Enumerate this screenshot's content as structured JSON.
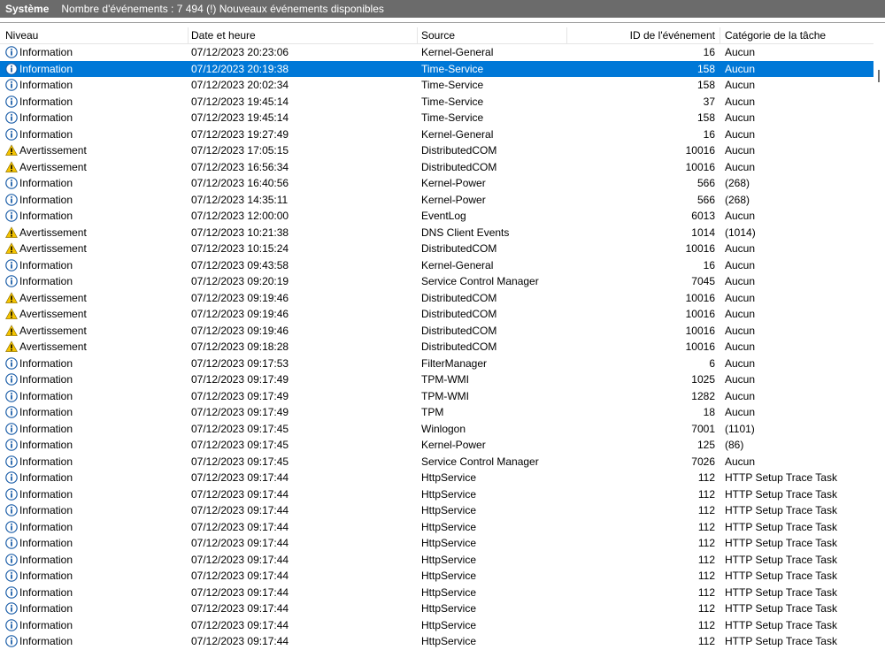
{
  "titlebar": {
    "title": "Système",
    "info": "Nombre d'événements : 7 494 (!) Nouveaux événements disponibles"
  },
  "columns": {
    "level": "Niveau",
    "date": "Date et heure",
    "source": "Source",
    "id": "ID de l'événement",
    "category": "Catégorie de la tâche"
  },
  "selected_row_index": 1,
  "rows": [
    {
      "level": "Information",
      "icon": "info",
      "date": "07/12/2023 20:23:06",
      "source": "Kernel-General",
      "id": "16",
      "category": "Aucun"
    },
    {
      "level": "Information",
      "icon": "info",
      "date": "07/12/2023 20:19:38",
      "source": "Time-Service",
      "id": "158",
      "category": "Aucun"
    },
    {
      "level": "Information",
      "icon": "info",
      "date": "07/12/2023 20:02:34",
      "source": "Time-Service",
      "id": "158",
      "category": "Aucun"
    },
    {
      "level": "Information",
      "icon": "info",
      "date": "07/12/2023 19:45:14",
      "source": "Time-Service",
      "id": "37",
      "category": "Aucun"
    },
    {
      "level": "Information",
      "icon": "info",
      "date": "07/12/2023 19:45:14",
      "source": "Time-Service",
      "id": "158",
      "category": "Aucun"
    },
    {
      "level": "Information",
      "icon": "info",
      "date": "07/12/2023 19:27:49",
      "source": "Kernel-General",
      "id": "16",
      "category": "Aucun"
    },
    {
      "level": "Avertissement",
      "icon": "warning",
      "date": "07/12/2023 17:05:15",
      "source": "DistributedCOM",
      "id": "10016",
      "category": "Aucun"
    },
    {
      "level": "Avertissement",
      "icon": "warning",
      "date": "07/12/2023 16:56:34",
      "source": "DistributedCOM",
      "id": "10016",
      "category": "Aucun"
    },
    {
      "level": "Information",
      "icon": "info",
      "date": "07/12/2023 16:40:56",
      "source": "Kernel-Power",
      "id": "566",
      "category": "(268)"
    },
    {
      "level": "Information",
      "icon": "info",
      "date": "07/12/2023 14:35:11",
      "source": "Kernel-Power",
      "id": "566",
      "category": "(268)"
    },
    {
      "level": "Information",
      "icon": "info",
      "date": "07/12/2023 12:00:00",
      "source": "EventLog",
      "id": "6013",
      "category": "Aucun"
    },
    {
      "level": "Avertissement",
      "icon": "warning",
      "date": "07/12/2023 10:21:38",
      "source": "DNS Client Events",
      "id": "1014",
      "category": "(1014)"
    },
    {
      "level": "Avertissement",
      "icon": "warning",
      "date": "07/12/2023 10:15:24",
      "source": "DistributedCOM",
      "id": "10016",
      "category": "Aucun"
    },
    {
      "level": "Information",
      "icon": "info",
      "date": "07/12/2023 09:43:58",
      "source": "Kernel-General",
      "id": "16",
      "category": "Aucun"
    },
    {
      "level": "Information",
      "icon": "info",
      "date": "07/12/2023 09:20:19",
      "source": "Service Control Manager",
      "id": "7045",
      "category": "Aucun"
    },
    {
      "level": "Avertissement",
      "icon": "warning",
      "date": "07/12/2023 09:19:46",
      "source": "DistributedCOM",
      "id": "10016",
      "category": "Aucun"
    },
    {
      "level": "Avertissement",
      "icon": "warning",
      "date": "07/12/2023 09:19:46",
      "source": "DistributedCOM",
      "id": "10016",
      "category": "Aucun"
    },
    {
      "level": "Avertissement",
      "icon": "warning",
      "date": "07/12/2023 09:19:46",
      "source": "DistributedCOM",
      "id": "10016",
      "category": "Aucun"
    },
    {
      "level": "Avertissement",
      "icon": "warning",
      "date": "07/12/2023 09:18:28",
      "source": "DistributedCOM",
      "id": "10016",
      "category": "Aucun"
    },
    {
      "level": "Information",
      "icon": "info",
      "date": "07/12/2023 09:17:53",
      "source": "FilterManager",
      "id": "6",
      "category": "Aucun"
    },
    {
      "level": "Information",
      "icon": "info",
      "date": "07/12/2023 09:17:49",
      "source": "TPM-WMI",
      "id": "1025",
      "category": "Aucun"
    },
    {
      "level": "Information",
      "icon": "info",
      "date": "07/12/2023 09:17:49",
      "source": "TPM-WMI",
      "id": "1282",
      "category": "Aucun"
    },
    {
      "level": "Information",
      "icon": "info",
      "date": "07/12/2023 09:17:49",
      "source": "TPM",
      "id": "18",
      "category": "Aucun"
    },
    {
      "level": "Information",
      "icon": "info",
      "date": "07/12/2023 09:17:45",
      "source": "Winlogon",
      "id": "7001",
      "category": "(1101)"
    },
    {
      "level": "Information",
      "icon": "info",
      "date": "07/12/2023 09:17:45",
      "source": "Kernel-Power",
      "id": "125",
      "category": "(86)"
    },
    {
      "level": "Information",
      "icon": "info",
      "date": "07/12/2023 09:17:45",
      "source": "Service Control Manager",
      "id": "7026",
      "category": "Aucun"
    },
    {
      "level": "Information",
      "icon": "info",
      "date": "07/12/2023 09:17:44",
      "source": "HttpService",
      "id": "112",
      "category": "HTTP Setup Trace Task"
    },
    {
      "level": "Information",
      "icon": "info",
      "date": "07/12/2023 09:17:44",
      "source": "HttpService",
      "id": "112",
      "category": "HTTP Setup Trace Task"
    },
    {
      "level": "Information",
      "icon": "info",
      "date": "07/12/2023 09:17:44",
      "source": "HttpService",
      "id": "112",
      "category": "HTTP Setup Trace Task"
    },
    {
      "level": "Information",
      "icon": "info",
      "date": "07/12/2023 09:17:44",
      "source": "HttpService",
      "id": "112",
      "category": "HTTP Setup Trace Task"
    },
    {
      "level": "Information",
      "icon": "info",
      "date": "07/12/2023 09:17:44",
      "source": "HttpService",
      "id": "112",
      "category": "HTTP Setup Trace Task"
    },
    {
      "level": "Information",
      "icon": "info",
      "date": "07/12/2023 09:17:44",
      "source": "HttpService",
      "id": "112",
      "category": "HTTP Setup Trace Task"
    },
    {
      "level": "Information",
      "icon": "info",
      "date": "07/12/2023 09:17:44",
      "source": "HttpService",
      "id": "112",
      "category": "HTTP Setup Trace Task"
    },
    {
      "level": "Information",
      "icon": "info",
      "date": "07/12/2023 09:17:44",
      "source": "HttpService",
      "id": "112",
      "category": "HTTP Setup Trace Task"
    },
    {
      "level": "Information",
      "icon": "info",
      "date": "07/12/2023 09:17:44",
      "source": "HttpService",
      "id": "112",
      "category": "HTTP Setup Trace Task"
    },
    {
      "level": "Information",
      "icon": "info",
      "date": "07/12/2023 09:17:44",
      "source": "HttpService",
      "id": "112",
      "category": "HTTP Setup Trace Task"
    },
    {
      "level": "Information",
      "icon": "info",
      "date": "07/12/2023 09:17:44",
      "source": "HttpService",
      "id": "112",
      "category": "HTTP Setup Trace Task"
    }
  ]
}
